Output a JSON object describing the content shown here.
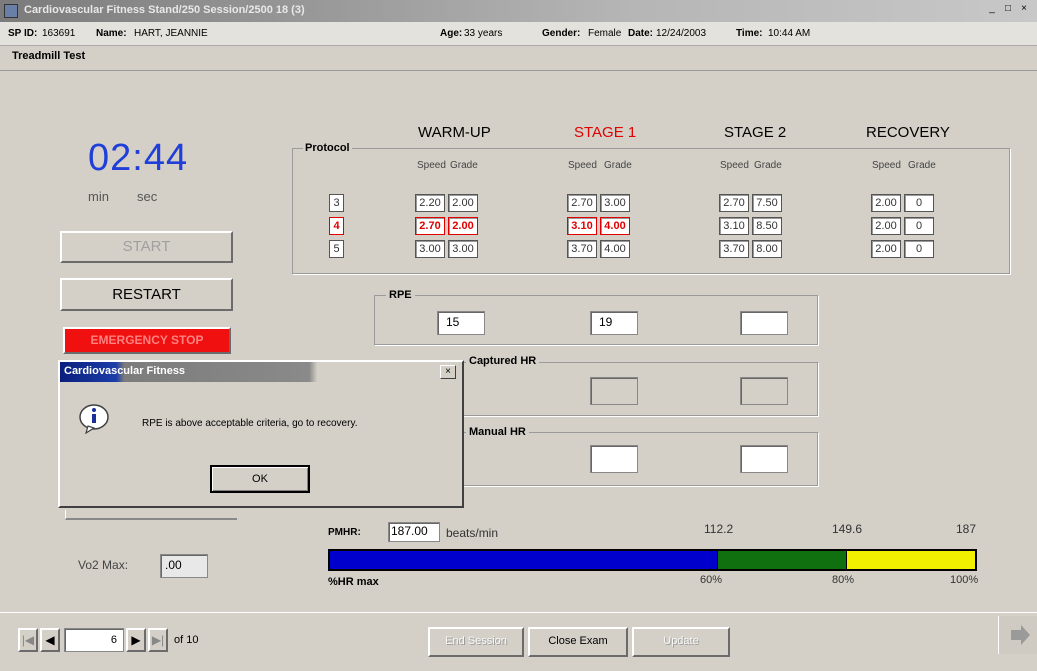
{
  "window": {
    "title": "Cardiovascular Fitness Stand/250 Session/2500 18 (3)",
    "min_label": "_",
    "max_label": "□",
    "close_label": "×"
  },
  "info": {
    "sp_id_label": "SP ID:",
    "sp_id_value": "163691",
    "name_label": "Name:",
    "name_value": "HART, JEANNIE",
    "age_label": "Age:",
    "age_value": "33 years",
    "gender_label": "Gender:",
    "gender_value": "Female",
    "date_label": "Date:",
    "date_value": "12/24/2003",
    "time_label": "Time:",
    "time_value": "10:44 AM"
  },
  "section_title": "Treadmill Test",
  "timer": {
    "minutes": "02",
    "separator": ":",
    "seconds": "44",
    "min_label": "min",
    "sec_label": "sec"
  },
  "buttons": {
    "start": "START",
    "restart": "RESTART",
    "emergency_stop": "EMERGENCY STOP"
  },
  "protocol_table": {
    "protocol_label": "Protocol",
    "stages": [
      {
        "name": "WARM-UP",
        "color": "#000000"
      },
      {
        "name": "STAGE 1",
        "color": "#e00000"
      },
      {
        "name": "STAGE 2",
        "color": "#000000"
      },
      {
        "name": "RECOVERY",
        "color": "#000000"
      }
    ],
    "speed_label": "Speed",
    "grade_label": "Grade",
    "rows": [
      {
        "protocol": "3",
        "active": false,
        "values": [
          "2.20",
          "2.00",
          "2.70",
          "3.00",
          "2.70",
          "7.50",
          "2.00",
          "0"
        ]
      },
      {
        "protocol": "4",
        "active": true,
        "values": [
          "2.70",
          "2.00",
          "3.10",
          "4.00",
          "3.10",
          "8.50",
          "2.00",
          "0"
        ]
      },
      {
        "protocol": "5",
        "active": false,
        "values": [
          "3.00",
          "3.00",
          "3.70",
          "4.00",
          "3.70",
          "8.00",
          "2.00",
          "0"
        ]
      }
    ]
  },
  "rpe": {
    "label": "RPE",
    "values": [
      "15",
      "19",
      ""
    ]
  },
  "captured_hr": {
    "label": "Captured HR"
  },
  "manual_hr": {
    "label": "Manual HR"
  },
  "pmhr": {
    "label": "PMHR:",
    "value": "187.00",
    "unit": "beats/min",
    "tick_values": [
      "112.2",
      "149.6",
      "187"
    ],
    "axis_label": "%HR max",
    "percent_labels": [
      "60%",
      "80%",
      "100%"
    ],
    "segments": [
      {
        "name": "below-60",
        "fraction": 0.6,
        "color": "#0000cc"
      },
      {
        "name": "60-80",
        "fraction": 0.2,
        "color": "#107010"
      },
      {
        "name": "80-100",
        "fraction": 0.2,
        "color": "#f0f000"
      }
    ]
  },
  "vo2": {
    "label": "Vo2 Max:",
    "value": ".00"
  },
  "dialog": {
    "title": "Cardiovascular Fitness",
    "close_label": "×",
    "message": "RPE is above acceptable criteria, go to recovery.",
    "ok_label": "OK",
    "icon": "info-icon"
  },
  "navigation": {
    "first": "|◀",
    "prev": "◀",
    "current": "6",
    "next": "▶",
    "last": "▶|",
    "of_label": "of 10",
    "end_session": "End Session",
    "close_exam": "Close Exam",
    "third_button": "Update"
  }
}
